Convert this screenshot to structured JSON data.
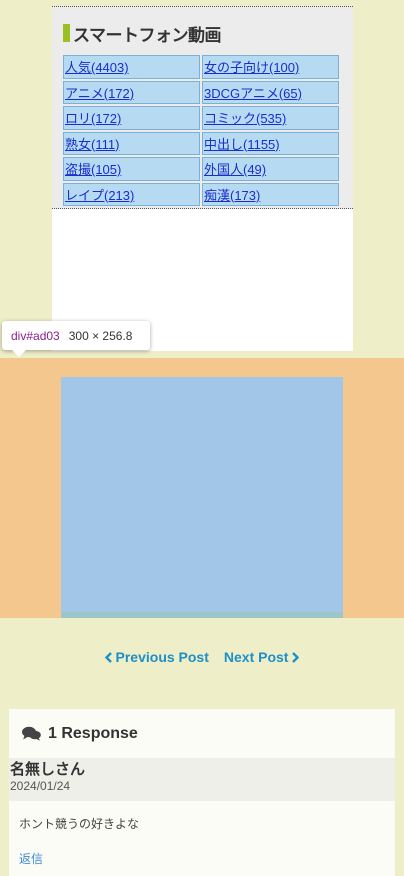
{
  "widget": {
    "title": "スマートフォン動画",
    "categories": [
      [
        "人気(4403)",
        "女の子向け(100)"
      ],
      [
        "アニメ(172)",
        "3DCGアニメ(65)"
      ],
      [
        "ロリ(172)",
        "コミック(535)"
      ],
      [
        "熟女(111)",
        "中出し(1155)"
      ],
      [
        "盗撮(105)",
        "外国人(49)"
      ],
      [
        "レイプ(213)",
        "痴漢(173)"
      ]
    ],
    "accent_color": "#9dbf24"
  },
  "devtools_tooltip": {
    "selector": "div#ad03",
    "dimensions": "300 × 256.8"
  },
  "post_nav": {
    "previous_label": "Previous Post",
    "next_label": "Next Post",
    "previous_icon": "chevron-left-icon",
    "next_icon": "chevron-right-icon",
    "link_color": "#1e8fc9"
  },
  "comments": {
    "count_label": "1 Response",
    "icon": "comments-icon",
    "items": [
      {
        "author": "名無しさん",
        "date": "2024/01/24",
        "text": "ホント競うの好きよな",
        "reply_label": "返信"
      }
    ]
  }
}
